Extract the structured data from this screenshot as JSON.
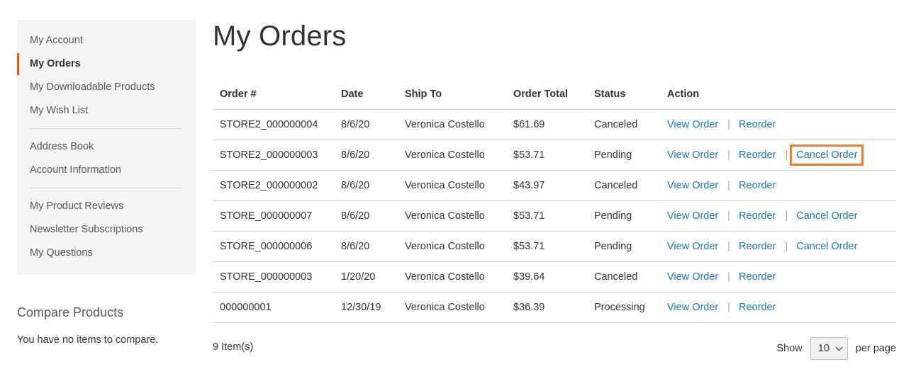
{
  "sidebar": {
    "groups": [
      [
        "My Account",
        "My Orders",
        "My Downloadable Products",
        "My Wish List"
      ],
      [
        "Address Book",
        "Account Information"
      ],
      [
        "My Product Reviews",
        "Newsletter Subscriptions",
        "My Questions"
      ]
    ],
    "active": "My Orders"
  },
  "compare": {
    "title": "Compare Products",
    "empty_text": "You have no items to compare."
  },
  "page_title": "My Orders",
  "table": {
    "headers": [
      "Order #",
      "Date",
      "Ship To",
      "Order Total",
      "Status",
      "Action"
    ],
    "view_label": "View Order",
    "reorder_label": "Reorder",
    "cancel_label": "Cancel Order",
    "separator": "|",
    "rows": [
      {
        "order": "STORE2_000000004",
        "date": "8/6/20",
        "ship_to": "Veronica Costello",
        "total": "$61.69",
        "status": "Canceled",
        "cancelable": false,
        "highlight": false
      },
      {
        "order": "STORE2_000000003",
        "date": "8/6/20",
        "ship_to": "Veronica Costello",
        "total": "$53.71",
        "status": "Pending",
        "cancelable": true,
        "highlight": true
      },
      {
        "order": "STORE2_000000002",
        "date": "8/6/20",
        "ship_to": "Veronica Costello",
        "total": "$43.97",
        "status": "Canceled",
        "cancelable": false,
        "highlight": false
      },
      {
        "order": "STORE_000000007",
        "date": "8/6/20",
        "ship_to": "Veronica Costello",
        "total": "$53.71",
        "status": "Pending",
        "cancelable": true,
        "highlight": false
      },
      {
        "order": "STORE_000000006",
        "date": "8/6/20",
        "ship_to": "Veronica Costello",
        "total": "$53.71",
        "status": "Pending",
        "cancelable": true,
        "highlight": false
      },
      {
        "order": "STORE_000000003",
        "date": "1/20/20",
        "ship_to": "Veronica Costello",
        "total": "$39.64",
        "status": "Canceled",
        "cancelable": false,
        "highlight": false
      },
      {
        "order": "000000001",
        "date": "12/30/19",
        "ship_to": "Veronica Costello",
        "total": "$36.39",
        "status": "Processing",
        "cancelable": false,
        "highlight": false
      }
    ]
  },
  "toolbar": {
    "item_count": "9 Item(s)",
    "show_label": "Show",
    "limit_value": "10",
    "per_page_label": "per page"
  },
  "colors": {
    "accent": "#ff5501",
    "link": "#1979c3",
    "highlight_border": "#f37b2a",
    "sidebar_bg": "#f5f5f5"
  }
}
